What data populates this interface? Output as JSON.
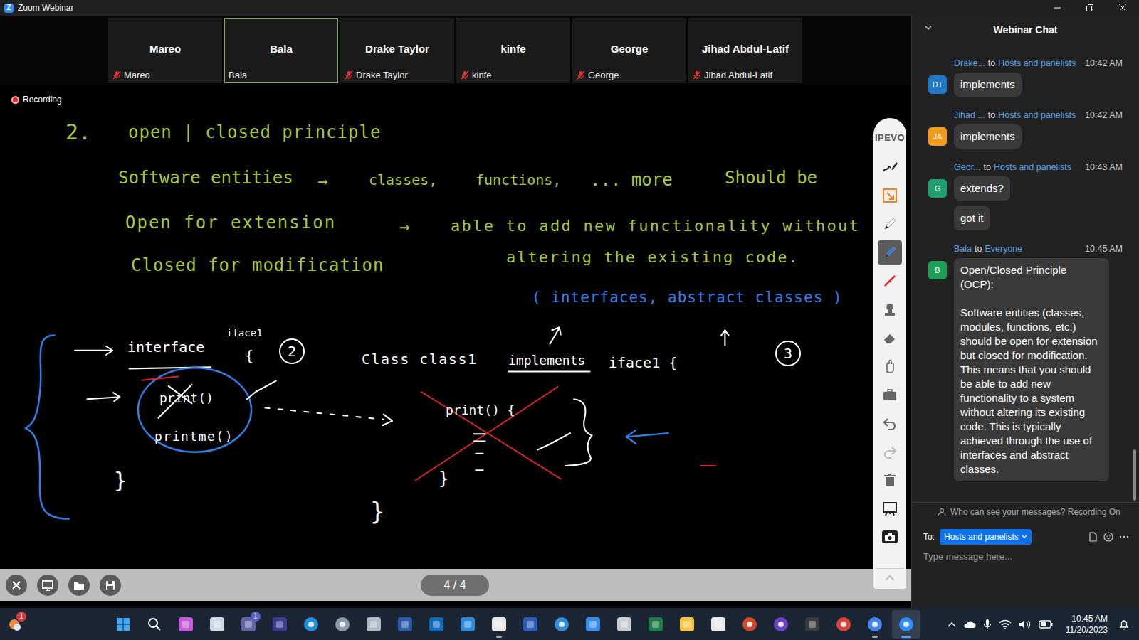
{
  "window": {
    "logo": "Z",
    "title": "Zoom Webinar"
  },
  "participants": [
    {
      "name": "Mareo",
      "label": "Mareo",
      "muted": true,
      "selected": false
    },
    {
      "name": "Bala",
      "label": "Bala",
      "muted": false,
      "selected": true
    },
    {
      "name": "Drake Taylor",
      "label": "Drake Taylor",
      "muted": true,
      "selected": false
    },
    {
      "name": "kinfe",
      "label": "kinfe",
      "muted": true,
      "selected": false
    },
    {
      "name": "George",
      "label": "George",
      "muted": true,
      "selected": false
    },
    {
      "name": "Jihad Abdul-Latif",
      "label": "Jihad Abdul-Latif",
      "muted": true,
      "selected": false
    }
  ],
  "recording": {
    "label": "Recording",
    "on": true
  },
  "whiteboard": {
    "notes": [
      {
        "text": "2.",
        "color": "#a6c93a"
      },
      {
        "text": "open | closed principle",
        "color": "#a6c93a"
      },
      {
        "text": "Software entities",
        "color": "#a6c93a"
      },
      {
        "text": "→",
        "color": "#a6c93a"
      },
      {
        "text": "classes,",
        "color": "#a6c93a"
      },
      {
        "text": "functions,",
        "color": "#a6c93a"
      },
      {
        "text": "... more",
        "color": "#a6c93a"
      },
      {
        "text": "Should be",
        "color": "#a6c93a"
      },
      {
        "text": "Open for extension",
        "color": "#a6c93a"
      },
      {
        "text": "→",
        "color": "#a6c93a"
      },
      {
        "text": "able to add new functionality without",
        "color": "#a6c93a"
      },
      {
        "text": "Closed for modification",
        "color": "#a6c93a"
      },
      {
        "text": "altering the existing code.",
        "color": "#a6c93a"
      },
      {
        "text": "( interfaces, abstract classes )",
        "color": "#2f7fe6"
      },
      {
        "text": "interface",
        "color": "#ffffff"
      },
      {
        "text": "iface1",
        "color": "#ffffff"
      },
      {
        "text": "{",
        "color": "#ffffff"
      },
      {
        "text": "print()",
        "color": "#ffffff"
      },
      {
        "text": "printme()",
        "color": "#ffffff"
      },
      {
        "text": "}",
        "color": "#ffffff"
      },
      {
        "text": "Class class1",
        "color": "#ffffff"
      },
      {
        "text": "implements",
        "color": "#ffffff"
      },
      {
        "text": "iface1 {",
        "color": "#ffffff"
      },
      {
        "text": "print() {",
        "color": "#ffffff"
      },
      {
        "text": "}",
        "color": "#ffffff"
      },
      {
        "text": "}",
        "color": "#ffffff"
      }
    ],
    "circled": [
      {
        "text": "2"
      },
      {
        "text": "3"
      }
    ]
  },
  "toolbar": {
    "brand": "IPEVO",
    "tools": [
      {
        "kind": "signature",
        "selected": false,
        "disabled": false
      },
      {
        "kind": "capture",
        "selected": false,
        "disabled": false
      },
      {
        "kind": "pen",
        "color": "#ffffff",
        "selected": false,
        "disabled": false
      },
      {
        "kind": "pen",
        "color": "#2f7fe6",
        "selected": true,
        "disabled": false
      },
      {
        "kind": "line",
        "color": "#e02424",
        "selected": false,
        "disabled": false
      },
      {
        "kind": "stamp",
        "selected": false,
        "disabled": false
      },
      {
        "kind": "eraser",
        "selected": false,
        "disabled": false
      },
      {
        "kind": "hand",
        "selected": false,
        "disabled": false
      },
      {
        "kind": "toolbox",
        "selected": false,
        "disabled": false
      },
      {
        "kind": "undo",
        "selected": false,
        "disabled": false
      },
      {
        "kind": "redo",
        "selected": false,
        "disabled": true
      },
      {
        "kind": "trash",
        "selected": false,
        "disabled": false
      },
      {
        "kind": "board",
        "selected": false,
        "disabled": false
      },
      {
        "kind": "camera",
        "selected": false,
        "disabled": false
      }
    ]
  },
  "pager": {
    "page": "4 / 4"
  },
  "chat": {
    "title": "Webinar Chat",
    "messages": [
      {
        "sender": "Drake...",
        "connector": "to",
        "recipient": "Hosts and panelists",
        "time": "10:42 AM",
        "initials": "DT",
        "color": "#1f78c8",
        "bubbles": [
          "implements"
        ]
      },
      {
        "sender": "Jihad ...",
        "connector": "to",
        "recipient": "Hosts and panelists",
        "time": "10:42 AM",
        "initials": "JA",
        "color": "#f29a1a",
        "bubbles": [
          "implements"
        ]
      },
      {
        "sender": "Geor...",
        "connector": "to",
        "recipient": "Hosts and panelists",
        "time": "10:43 AM",
        "initials": "G",
        "color": "#1f9e6e",
        "bubbles": [
          "extends?",
          "got it"
        ]
      },
      {
        "sender": "Bala",
        "connector": "to",
        "recipient": "Everyone",
        "time": "10:45 AM",
        "initials": "B",
        "color": "#1f9e55",
        "bubbles": [
          "Open/Closed Principle (OCP):\n\nSoftware entities (classes, modules, functions, etc.) should be open for extension but closed for modification.\nThis means that you should be able to add new functionality to a system without altering its existing code. This is typically achieved through the use of interfaces and abstract classes."
        ]
      }
    ],
    "notice": "Who can see your messages? Recording On",
    "to_label": "To:",
    "recipient_select": "Hosts and panelists",
    "placeholder": "Type message here..."
  },
  "taskbar": {
    "apps": [
      {
        "kind": "weather",
        "color": "#f08a3c",
        "running": false,
        "selected": false,
        "badge": "1"
      },
      {
        "kind": "start",
        "color": "#3ea6f5",
        "running": false,
        "selected": false
      },
      {
        "kind": "search",
        "color": "#ffffff",
        "running": false,
        "selected": false
      },
      {
        "kind": "tile",
        "color": "#c45ad8",
        "running": false,
        "selected": false
      },
      {
        "kind": "tile",
        "color": "#cfd8e3",
        "running": false,
        "selected": false
      },
      {
        "kind": "tile",
        "color": "#6264a7",
        "running": false,
        "selected": false,
        "badge": "1"
      },
      {
        "kind": "tile",
        "color": "#3b3b8f",
        "running": false,
        "selected": false
      },
      {
        "kind": "round",
        "color": "#1f8fe0",
        "running": false,
        "selected": false
      },
      {
        "kind": "round",
        "color": "#8a9bb0",
        "running": false,
        "selected": false
      },
      {
        "kind": "tile",
        "color": "#b0b8c4",
        "running": false,
        "selected": false
      },
      {
        "kind": "tile",
        "color": "#2a5aa8",
        "running": false,
        "selected": false
      },
      {
        "kind": "tile",
        "color": "#0f6cbd",
        "running": false,
        "selected": false
      },
      {
        "kind": "tile",
        "color": "#2c8ad8",
        "running": false,
        "selected": false
      },
      {
        "kind": "tile",
        "color": "#e8e8e8",
        "running": true,
        "selected": false
      },
      {
        "kind": "tile",
        "color": "#2b5cb8",
        "running": false,
        "selected": false
      },
      {
        "kind": "round",
        "color": "#2d8fd8",
        "running": false,
        "selected": false
      },
      {
        "kind": "tile",
        "color": "#3a8ee6",
        "running": false,
        "selected": false
      },
      {
        "kind": "tile",
        "color": "#c9ccd2",
        "running": false,
        "selected": false
      },
      {
        "kind": "tile",
        "color": "#1f7a45",
        "running": false,
        "selected": false
      },
      {
        "kind": "tile",
        "color": "#f4c542",
        "running": false,
        "selected": false
      },
      {
        "kind": "tile",
        "color": "#e8e8e8",
        "running": false,
        "selected": false
      },
      {
        "kind": "round",
        "color": "#d24726",
        "running": false,
        "selected": false
      },
      {
        "kind": "round",
        "color": "#6e40c9",
        "running": false,
        "selected": false
      },
      {
        "kind": "tile",
        "color": "#3a3a3a",
        "running": false,
        "selected": false
      },
      {
        "kind": "round",
        "color": "#db4437",
        "running": false,
        "selected": false
      },
      {
        "kind": "round",
        "color": "#4285f4",
        "running": true,
        "selected": false
      },
      {
        "kind": "round",
        "color": "#2d8cff",
        "running": true,
        "selected": true
      }
    ],
    "clock": {
      "time": "10:45 AM",
      "date": "11/20/2023"
    }
  }
}
